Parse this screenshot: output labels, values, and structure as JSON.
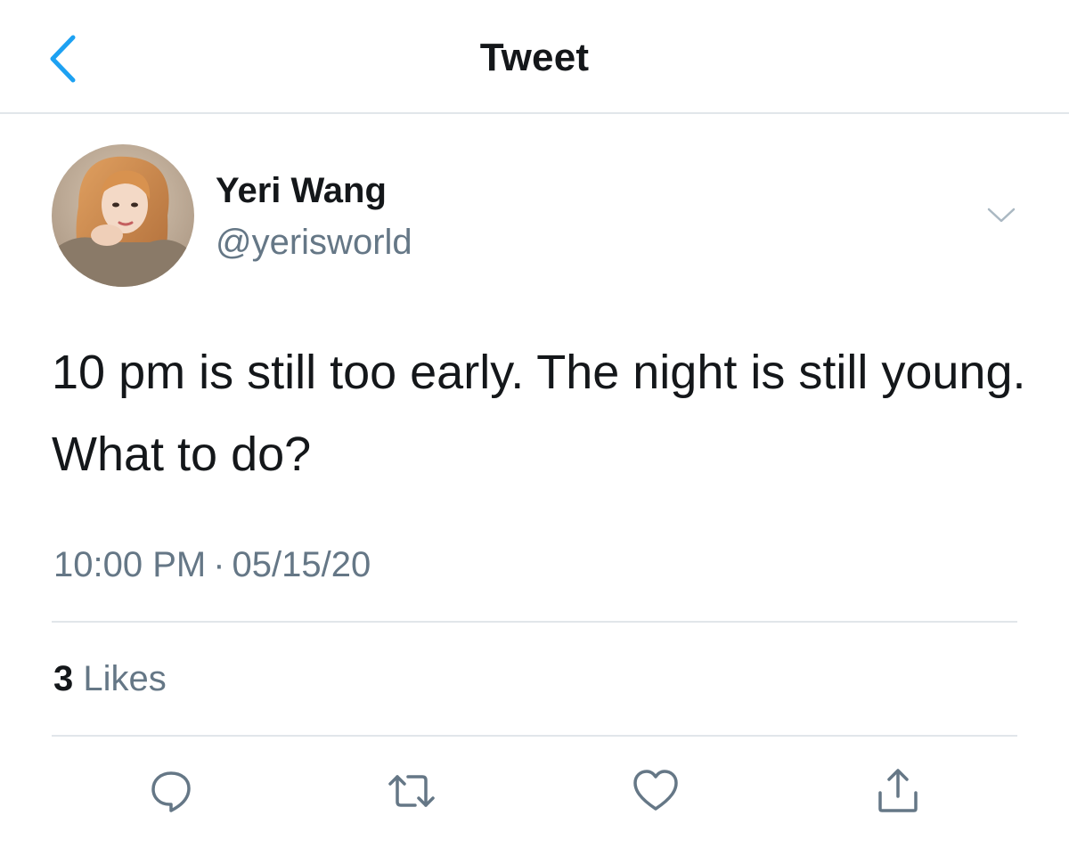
{
  "header": {
    "title": "Tweet",
    "back_icon": "chevron-left-icon",
    "accent_color": "#1da1f2"
  },
  "tweet": {
    "author": {
      "display_name": "Yeri Wang",
      "handle": "@yerisworld"
    },
    "text": "10 pm is still too early. The night is still young. What to do?",
    "time": "10:00 PM",
    "separator": "·",
    "date": "05/15/20",
    "likes": {
      "count": "3",
      "label": "Likes"
    }
  },
  "actions": {
    "reply_icon": "reply-bubble-icon",
    "retweet_icon": "retweet-icon",
    "like_icon": "heart-icon",
    "share_icon": "share-icon"
  },
  "colors": {
    "text_primary": "#14171a",
    "text_secondary": "#657786",
    "divider": "#e1e6ea",
    "icon": "#657786"
  }
}
